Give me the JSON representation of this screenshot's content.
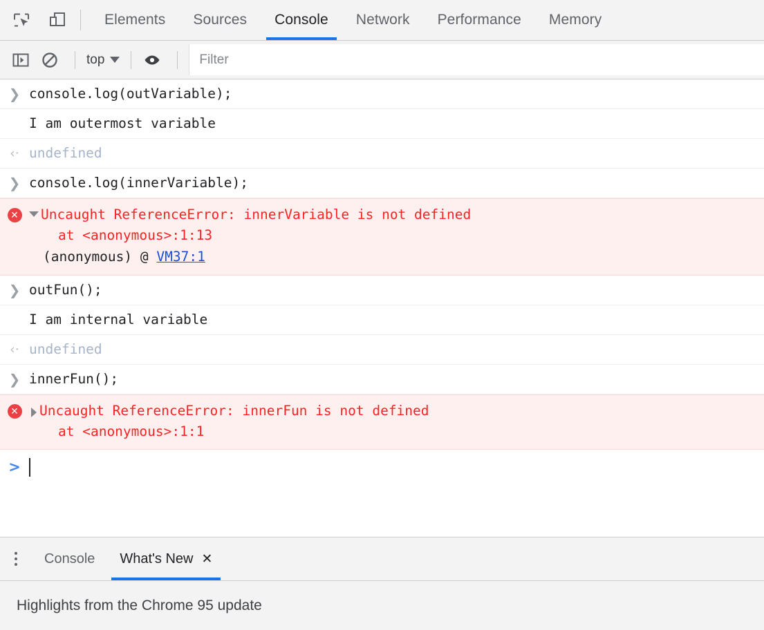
{
  "toolbar_top": {
    "icons": [
      {
        "name": "inspect-element-icon",
        "label": "Inspect element"
      },
      {
        "name": "device-toolbar-icon",
        "label": "Toggle device toolbar"
      }
    ],
    "tabs": [
      {
        "label": "Elements",
        "active": false
      },
      {
        "label": "Sources",
        "active": false
      },
      {
        "label": "Console",
        "active": true
      },
      {
        "label": "Network",
        "active": false
      },
      {
        "label": "Performance",
        "active": false
      },
      {
        "label": "Memory",
        "active": false
      }
    ]
  },
  "console_toolbar": {
    "sidebar_toggle_icon": "show-console-sidebar-icon",
    "clear_icon": "clear-console-icon",
    "context_value": "top",
    "eye_icon": "create-live-expression-icon",
    "filter_placeholder": "Filter",
    "filter_value": ""
  },
  "console_messages": [
    {
      "type": "input",
      "icon": "input-chevron-icon",
      "text": "console.log(outVariable);"
    },
    {
      "type": "log",
      "text": "I am outermost variable"
    },
    {
      "type": "result",
      "icon": "return-arrow-icon",
      "text": "undefined"
    },
    {
      "type": "input",
      "icon": "input-chevron-icon",
      "text": "console.log(innerVariable);"
    },
    {
      "type": "error",
      "icon": "error-badge-icon",
      "expanded": true,
      "disclosure": "expanded-triangle-icon",
      "message": "Uncaught ReferenceError: innerVariable is not defined",
      "stack": "at <anonymous>:1:13",
      "link_prefix": "(anonymous) @ ",
      "link_text": "VM37:1"
    },
    {
      "type": "input",
      "icon": "input-chevron-icon",
      "text": "outFun();"
    },
    {
      "type": "log",
      "text": "I am internal variable"
    },
    {
      "type": "result",
      "icon": "return-arrow-icon",
      "text": "undefined"
    },
    {
      "type": "input",
      "icon": "input-chevron-icon",
      "text": "innerFun();"
    },
    {
      "type": "error",
      "icon": "error-badge-icon",
      "expanded": false,
      "disclosure": "collapsed-triangle-icon",
      "message": "Uncaught ReferenceError: innerFun is not defined",
      "stack": "at <anonymous>:1:1"
    }
  ],
  "prompt": {
    "chevron": ">",
    "value": ""
  },
  "drawer": {
    "menu_icon": "more-options-kebab-icon",
    "tabs": [
      {
        "label": "Console",
        "active": false,
        "closable": false
      },
      {
        "label": "What's New",
        "active": true,
        "closable": true,
        "close_icon": "close-icon",
        "close_glyph": "✕"
      }
    ],
    "content_heading": "Highlights from the Chrome 95 update"
  },
  "glyphs": {
    "input_chevron": "❯",
    "return_arrow": "‹·",
    "error_mark": "✕"
  },
  "colors": {
    "accent_blue": "#1a73e8",
    "error_red": "#ff2222",
    "error_bg": "#fff0f0",
    "link_blue": "#1a4fd6",
    "toolbar_bg": "#f3f3f3"
  }
}
